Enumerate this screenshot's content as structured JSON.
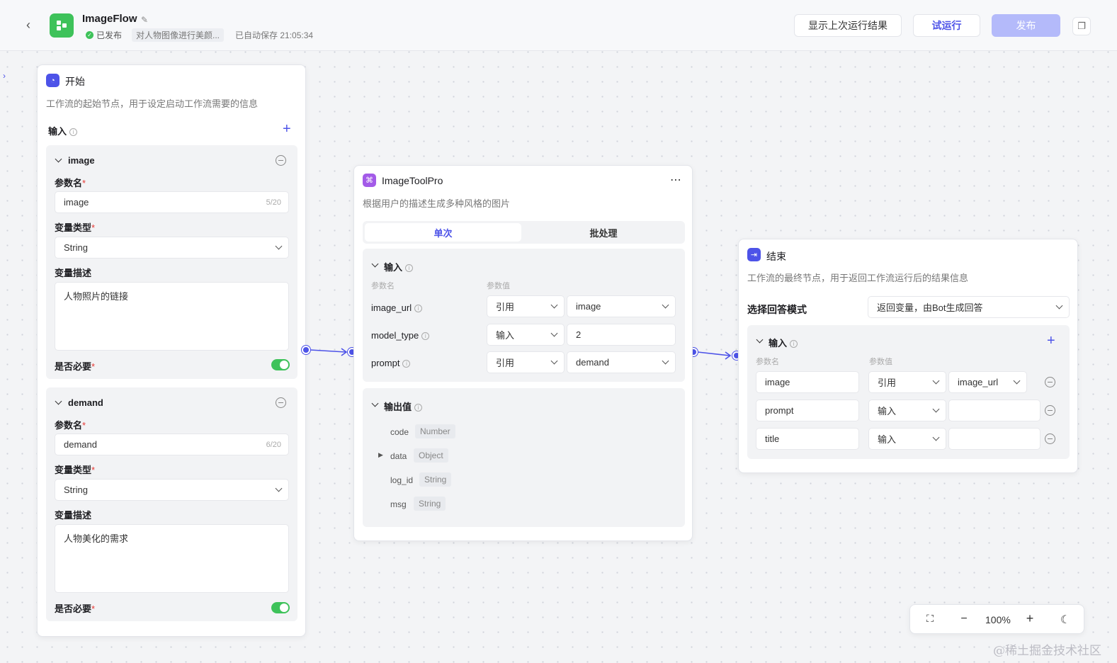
{
  "app": {
    "title": "ImageFlow",
    "status": "已发布",
    "description": "对人物图像进行美颜...",
    "autosave": "已自动保存 21:05:34"
  },
  "toolbar": {
    "show_last": "显示上次运行结果",
    "test_run": "试运行",
    "publish": "发布"
  },
  "start_node": {
    "title": "开始",
    "desc": "工作流的起始节点，用于设定启动工作流需要的信息",
    "input_label": "输入",
    "params": [
      {
        "section": "image",
        "name_label": "参数名",
        "name_value": "image",
        "name_count": "5/20",
        "type_label": "变量类型",
        "type_value": "String",
        "desc_label": "变量描述",
        "desc_value": "人物照片的链接",
        "required_label": "是否必要"
      },
      {
        "section": "demand",
        "name_label": "参数名",
        "name_value": "demand",
        "name_count": "6/20",
        "type_label": "变量类型",
        "type_value": "String",
        "desc_label": "变量描述",
        "desc_value": "人物美化的需求",
        "required_label": "是否必要"
      }
    ]
  },
  "tool_node": {
    "title": "ImageToolPro",
    "desc": "根据用户的描述生成多种风格的图片",
    "tabs": [
      "单次",
      "批处理"
    ],
    "input_label": "输入",
    "col_name": "参数名",
    "col_value": "参数值",
    "inputs": [
      {
        "name": "image_url",
        "mode": "引用",
        "value": "image"
      },
      {
        "name": "model_type",
        "mode": "输入",
        "value": "2"
      },
      {
        "name": "prompt",
        "mode": "引用",
        "value": "demand"
      }
    ],
    "output_label": "输出值",
    "outputs": [
      {
        "key": "code",
        "type": "Number"
      },
      {
        "key": "data",
        "type": "Object"
      },
      {
        "key": "log_id",
        "type": "String"
      },
      {
        "key": "msg",
        "type": "String"
      }
    ]
  },
  "end_node": {
    "title": "结束",
    "desc": "工作流的最终节点，用于返回工作流运行后的结果信息",
    "mode_label": "选择回答模式",
    "mode_value": "返回变量，由Bot生成回答",
    "input_label": "输入",
    "col_name": "参数名",
    "col_value": "参数值",
    "rows": [
      {
        "name": "image",
        "mode": "引用",
        "value": "image_url"
      },
      {
        "name": "prompt",
        "mode": "输入",
        "value": ""
      },
      {
        "name": "title",
        "mode": "输入",
        "value": ""
      }
    ]
  },
  "zoom": {
    "level": "100%"
  },
  "watermark": "@稀土掘金技术社区",
  "colors": {
    "accent": "#4d53e8",
    "success": "#3ec25a",
    "publish_disabled": "#b4bafa"
  }
}
